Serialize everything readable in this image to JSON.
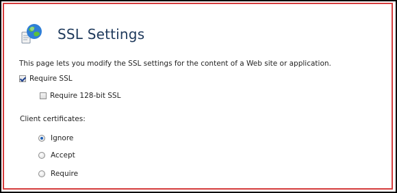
{
  "header": {
    "title": "SSL Settings",
    "icon": "globe-document-icon"
  },
  "description": "This page lets you modify the SSL settings for the content of a Web site or application.",
  "require_ssl": {
    "label": "Require SSL",
    "checked": true
  },
  "require_128": {
    "label": "Require 128-bit SSL",
    "checked": false
  },
  "client_certificates": {
    "label": "Client certificates:",
    "options": [
      {
        "label": "Ignore",
        "selected": true
      },
      {
        "label": "Accept",
        "selected": false
      },
      {
        "label": "Require",
        "selected": false
      }
    ]
  },
  "colors": {
    "panel_border": "#d43a3a",
    "title": "#1e395b",
    "frame": "#000000"
  }
}
